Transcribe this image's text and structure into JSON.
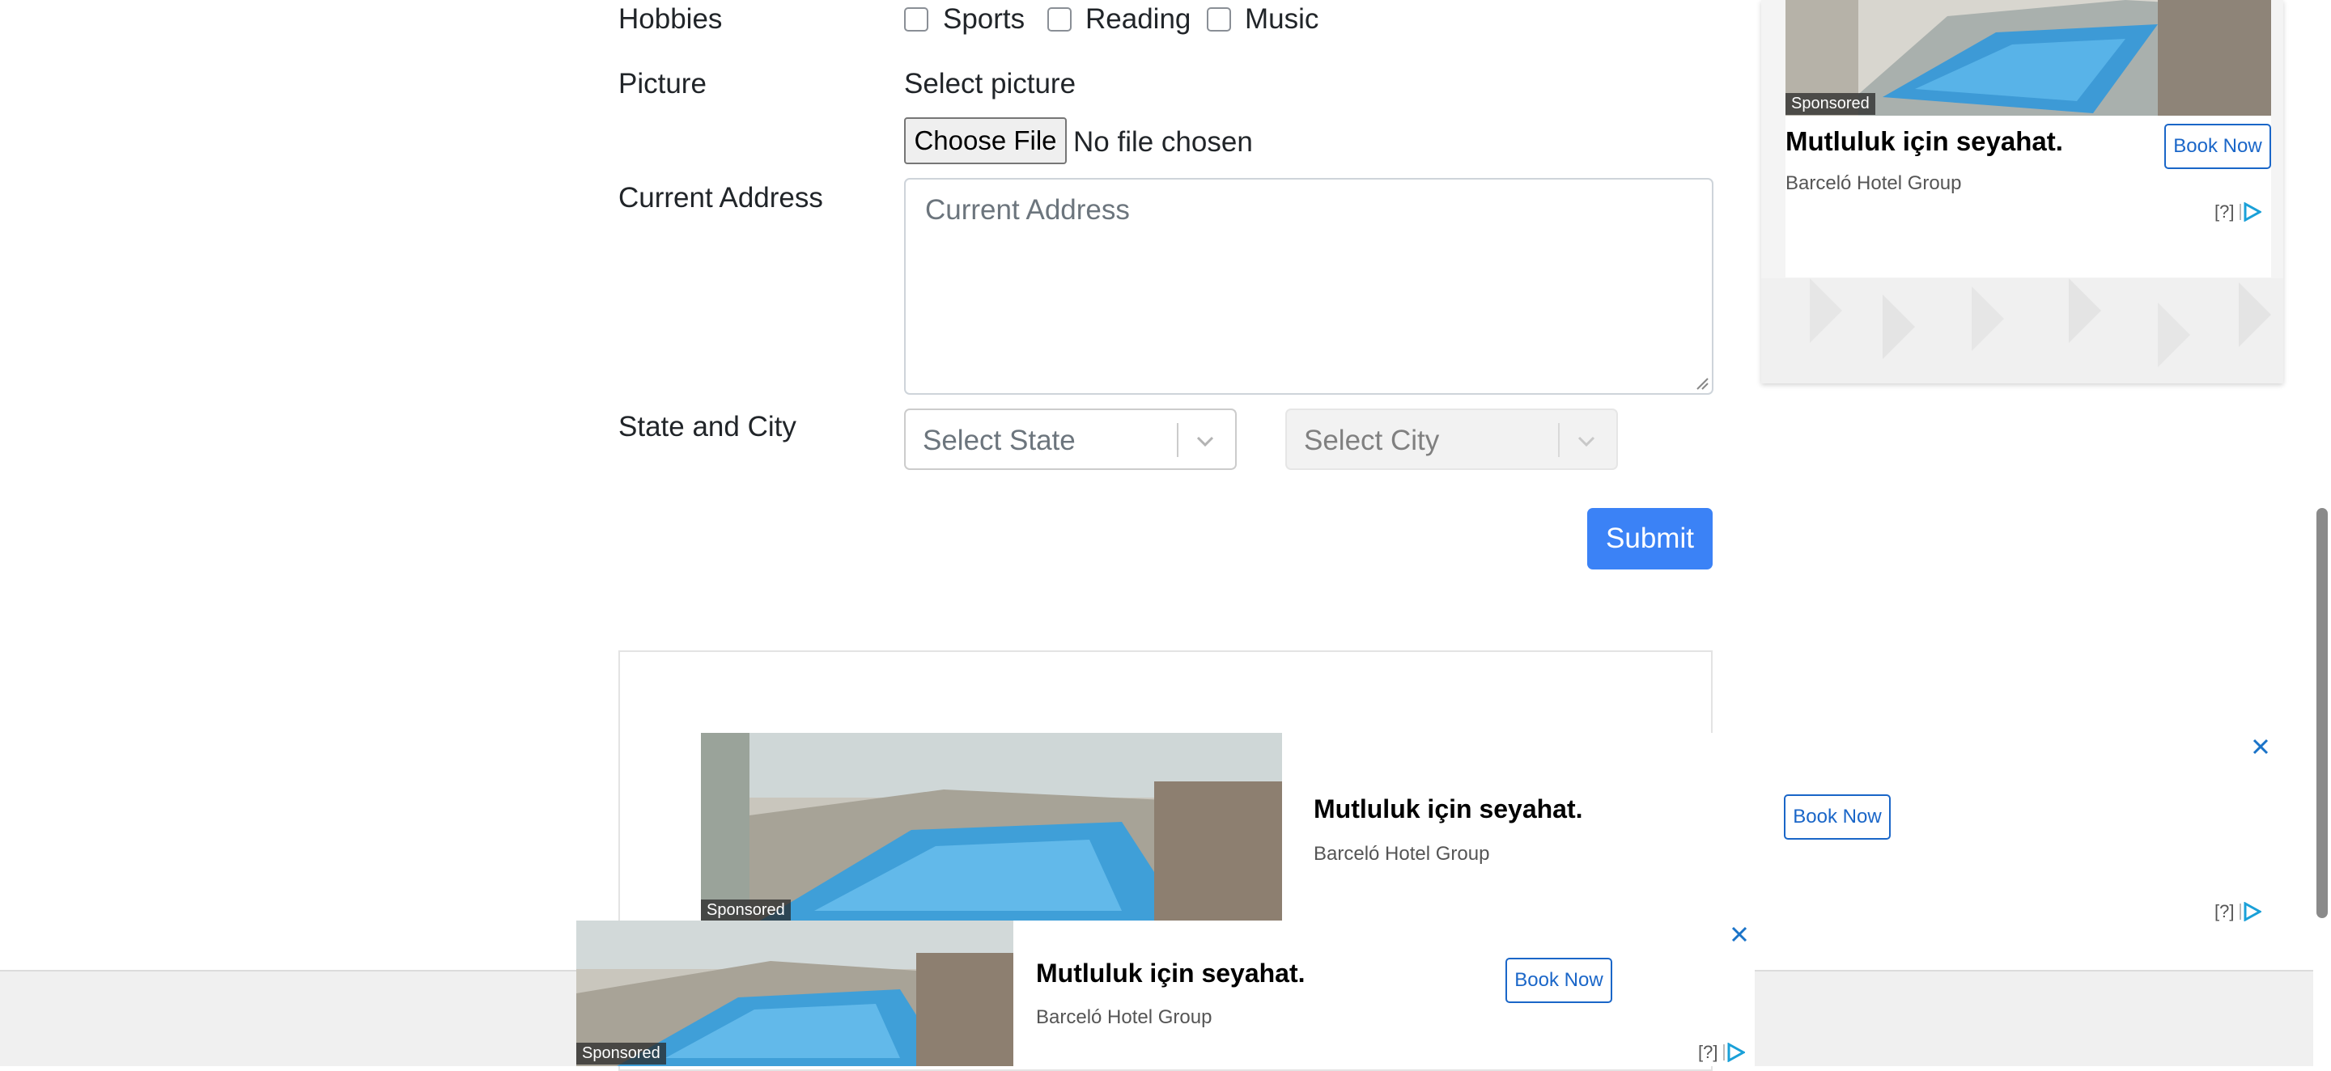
{
  "form": {
    "hobbies_label": "Hobbies",
    "hobbies": [
      "Sports",
      "Reading",
      "Music"
    ],
    "picture_label": "Picture",
    "select_picture": "Select picture",
    "choose_file": "Choose File",
    "no_file": "No file chosen",
    "address_label": "Current Address",
    "address_placeholder": "Current Address",
    "state_city_label": "State and City",
    "state_placeholder": "Select State",
    "city_placeholder": "Select City",
    "submit_label": "Submit"
  },
  "ads": {
    "sponsored": "Sponsored",
    "title": "Mutluluk için seyahat.",
    "advertiser": "Barceló Hotel Group",
    "book_now": "Book Now",
    "adchoice_text": "[?]"
  },
  "colors": {
    "submit_bg": "#3b82f6",
    "ad_button": "#1a66c8",
    "adchoice_icon": "#1aa0d8"
  }
}
